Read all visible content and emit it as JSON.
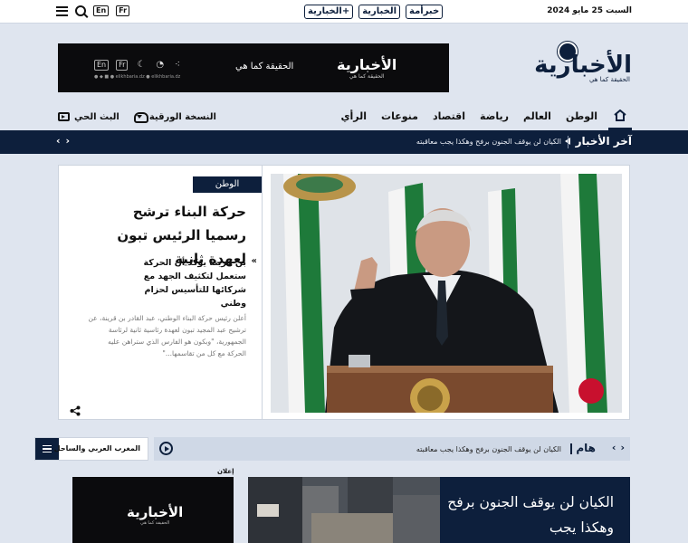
{
  "topbar": {
    "date": "السبت 25 مايو 2024",
    "brands": [
      "الخبارية+",
      "الخبارية",
      "خبرأمة"
    ],
    "lang_en": "En",
    "lang_fr": "Fr"
  },
  "header": {
    "logo_text": "الأخبارية",
    "logo_tagline": "الحقيقة كما هي",
    "banner_logo": "الأخبارية",
    "banner_logo_tag": "الحقيقة كما هي",
    "banner_slogan": "الحقيقة كما هي",
    "banner_line": "● ◆ ■ ● elikhbaria.dz   ● elikhbaria.dz"
  },
  "nav": {
    "items": [
      "الوطن",
      "العالم",
      "رياضة",
      "اقتصاد",
      "منوعات",
      "الرأي"
    ],
    "print_edition": "النسخة الورقية",
    "live": "البث الحي"
  },
  "ticker": {
    "label": "آخر الأخبار",
    "text": "الكيان لن يوقف الجنون برفح وهكذا يجب معاقبته"
  },
  "feature": {
    "category": "الوطن",
    "title": "حركة البناء ترشح رسميا الرئيس تبون لعهدة ثانية",
    "subtitle": "بن قرينة يؤكد أن الحركة ستعمل لتكثيف الجهد مع شركائها للتأسيس لحزام وطني",
    "excerpt": "أعلن رئيس حركة البناء الوطني، عبد القادر بن قرينة، عن ترشيح عبد المجيد تبون لعهدة رئاسية ثانية لرئاسة الجمهورية، \"وبكون هو الفارس الذي ستراهن عليه الحركة مع كل من تقاسمها...\""
  },
  "important": {
    "label": "هام",
    "text": "الكيان لن يوقف الجنون برفح وهكذا يجب معاقبته"
  },
  "section": {
    "label": "المغرب العربي والساحل"
  },
  "ad": {
    "label": "إعلان",
    "logo": "الأخبارية",
    "logo_tag": "الحقيقة كما هي"
  },
  "story2": {
    "title": "الكيان لن يوقف الجنون برفح وهكذا يجب"
  },
  "colors": {
    "navy": "#0d1f3c",
    "page_bg": "#dfe5ef",
    "hambar_bg": "#cfd8e6"
  }
}
